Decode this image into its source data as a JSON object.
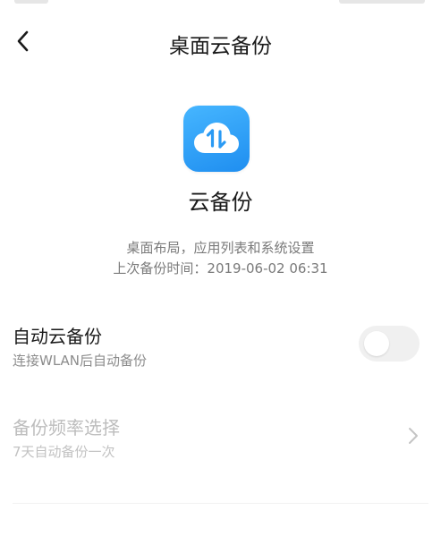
{
  "header": {
    "title": "桌面云备份",
    "back_icon": "chevron-left-icon"
  },
  "app": {
    "icon": "cloud-sync-icon",
    "icon_color": "#1f8ef0",
    "name": "云备份",
    "description": "桌面布局，应用列表和系统设置",
    "last_backup_label": "上次备份时间：",
    "last_backup_time": "2019-06-02 06:31"
  },
  "settings": {
    "auto_backup": {
      "title": "自动云备份",
      "subtitle": "连接WLAN后自动备份",
      "enabled": false
    },
    "frequency": {
      "title": "备份频率选择",
      "subtitle": "7天自动备份一次",
      "disabled": true,
      "icon": "chevron-right-icon"
    }
  }
}
